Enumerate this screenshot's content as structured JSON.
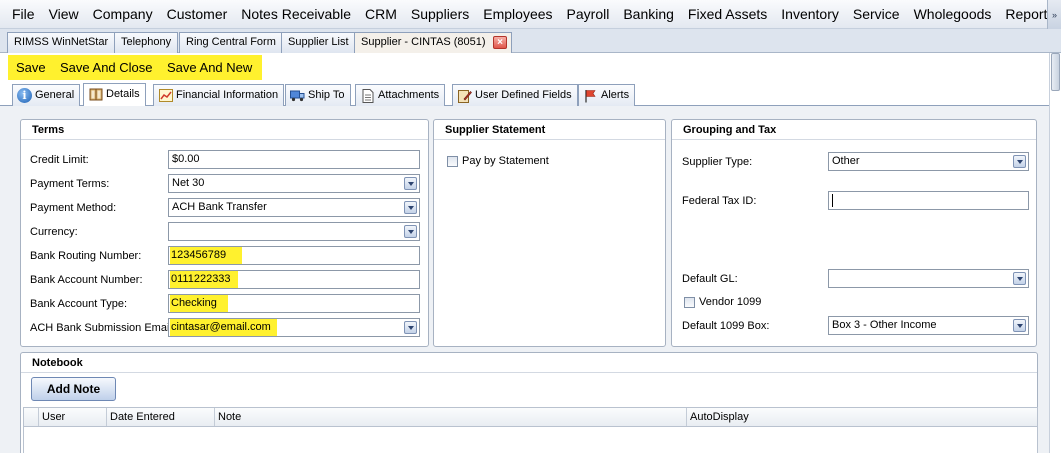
{
  "menubar": {
    "items": [
      "File",
      "View",
      "Company",
      "Customer",
      "Notes Receivable",
      "CRM",
      "Suppliers",
      "Employees",
      "Payroll",
      "Banking",
      "Fixed Assets",
      "Inventory",
      "Service",
      "Wholegoods",
      "Reports"
    ],
    "more_icon": "double-chevron-right-icon"
  },
  "doc_tabs": [
    "RIMSS WinNetStar",
    "Telephony",
    "Ring Central Form",
    "Supplier List",
    "Supplier - CINTAS (8051)"
  ],
  "toolbar": {
    "save_label": "Save",
    "save_close_label": "Save And Close",
    "save_new_label": "Save And New",
    "highlight_color": "#fff12e"
  },
  "section_tabs": [
    {
      "label": "General",
      "icon": "info-icon"
    },
    {
      "label": "Details",
      "icon": "book-icon"
    },
    {
      "label": "Financial Information",
      "icon": "chart-icon"
    },
    {
      "label": "Ship To",
      "icon": "truck-icon"
    },
    {
      "label": "Attachments",
      "icon": "document-icon"
    },
    {
      "label": "User Defined Fields",
      "icon": "form-edit-icon"
    },
    {
      "label": "Alerts",
      "icon": "flag-icon"
    }
  ],
  "terms": {
    "title": "Terms",
    "credit_limit_label": "Credit Limit:",
    "credit_limit_value": "$0.00",
    "payment_terms_label": "Payment Terms:",
    "payment_terms_value": "Net 30",
    "payment_method_label": "Payment Method:",
    "payment_method_value": "ACH Bank Transfer",
    "currency_label": "Currency:",
    "currency_value": "",
    "routing_label": "Bank Routing Number:",
    "routing_value": "123456789",
    "account_label": "Bank Account Number:",
    "account_value": "0111222333",
    "account_type_label": "Bank Account Type:",
    "account_type_value": "Checking",
    "ach_email_label": "ACH Bank Submission Email:",
    "ach_email_value": "cintasar@email.com"
  },
  "statement": {
    "title": "Supplier Statement",
    "pay_by_statement_label": "Pay by Statement",
    "pay_by_statement_checked": false
  },
  "grouping": {
    "title": "Grouping and Tax",
    "supplier_type_label": "Supplier Type:",
    "supplier_type_value": "Other",
    "federal_tax_label": "Federal Tax ID:",
    "federal_tax_value": "",
    "default_gl_label": "Default GL:",
    "default_gl_value": "",
    "vendor_1099_label": "Vendor 1099",
    "vendor_1099_checked": false,
    "default_1099_label": "Default 1099 Box:",
    "default_1099_value": "Box 3 - Other Income"
  },
  "notebook": {
    "title": "Notebook",
    "add_note_label": "Add Note",
    "columns": [
      "User",
      "Date Entered",
      "Note",
      "AutoDisplay"
    ]
  }
}
